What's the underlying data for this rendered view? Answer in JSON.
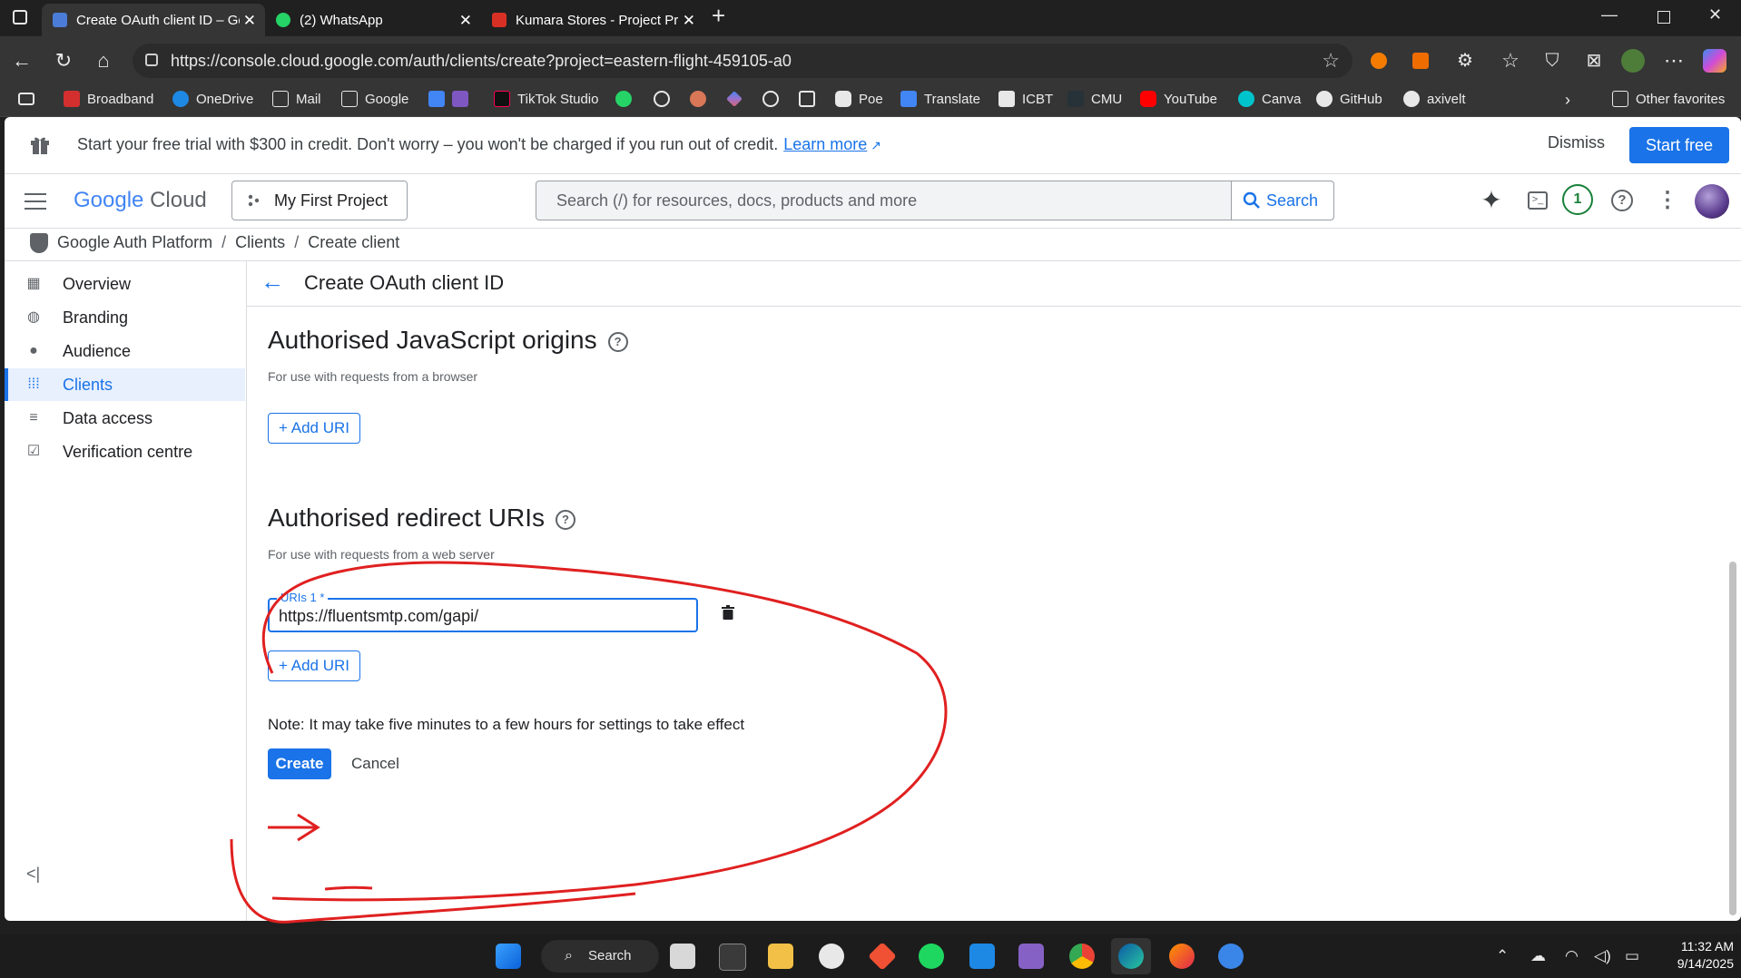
{
  "browser": {
    "tabs": [
      {
        "title": "Create OAuth client ID – Google A",
        "active": true,
        "favicon_color": "#4a7cd8"
      },
      {
        "title": "(2) WhatsApp",
        "active": false,
        "favicon_color": "#25d366",
        "badge": "2"
      },
      {
        "title": "Kumara Stores - Project Proposal.",
        "active": false,
        "favicon_color": "#d93025"
      }
    ],
    "url": "https://console.cloud.google.com/auth/clients/create?project=eastern-flight-459105-a0",
    "bookmarks": [
      "Broadband",
      "OneDrive",
      "Mail",
      "Google",
      "TikTok Studio",
      "Poe",
      "Translate",
      "ICBT",
      "CMU",
      "YouTube",
      "Canva",
      "GitHub",
      "axivelt"
    ],
    "other_favorites": "Other favorites"
  },
  "banner": {
    "text": "Start your free trial with $300 in credit. Don't worry – you won't be charged if you run out of credit.",
    "learn_more": "Learn more",
    "dismiss": "Dismiss",
    "start_free": "Start free"
  },
  "header": {
    "logo_google": "Google",
    "logo_cloud": "Cloud",
    "project": "My First Project",
    "search_placeholder": "Search (/) for resources, docs, products and more",
    "search_button": "Search",
    "notifications_count": "1"
  },
  "breadcrumb": [
    "Google Auth Platform",
    "Clients",
    "Create client"
  ],
  "sidebar": {
    "items": [
      {
        "label": "Overview",
        "icon": "dashboard-icon",
        "selected": false
      },
      {
        "label": "Branding",
        "icon": "palette-icon",
        "selected": false
      },
      {
        "label": "Audience",
        "icon": "person-icon",
        "selected": false
      },
      {
        "label": "Clients",
        "icon": "grid-icon",
        "selected": true
      },
      {
        "label": "Data access",
        "icon": "settings-list-icon",
        "selected": false
      },
      {
        "label": "Verification centre",
        "icon": "checkbox-icon",
        "selected": false
      }
    ],
    "collapse": "<|"
  },
  "main": {
    "title": "Create OAuth client ID",
    "js_origins": {
      "title": "Authorised JavaScript origins",
      "subtitle": "For use with requests from a browser",
      "add_button": "+ Add URI"
    },
    "redirect_uris": {
      "title": "Authorised redirect URIs",
      "subtitle": "For use with requests from a web server",
      "field_label": "URIs 1 *",
      "field_value": "https://fluentsmtp.com/gapi/",
      "add_button": "+ Add URI"
    },
    "note": "Note: It may take five minutes to a few hours for settings to take effect",
    "create_button": "Create",
    "cancel_button": "Cancel"
  },
  "taskbar": {
    "search": "Search",
    "time": "11:32 AM",
    "date": "9/14/2025"
  },
  "colors": {
    "accent": "#1a73e8",
    "annotation": "#e02020",
    "selected_bg": "#e8f0fe"
  }
}
